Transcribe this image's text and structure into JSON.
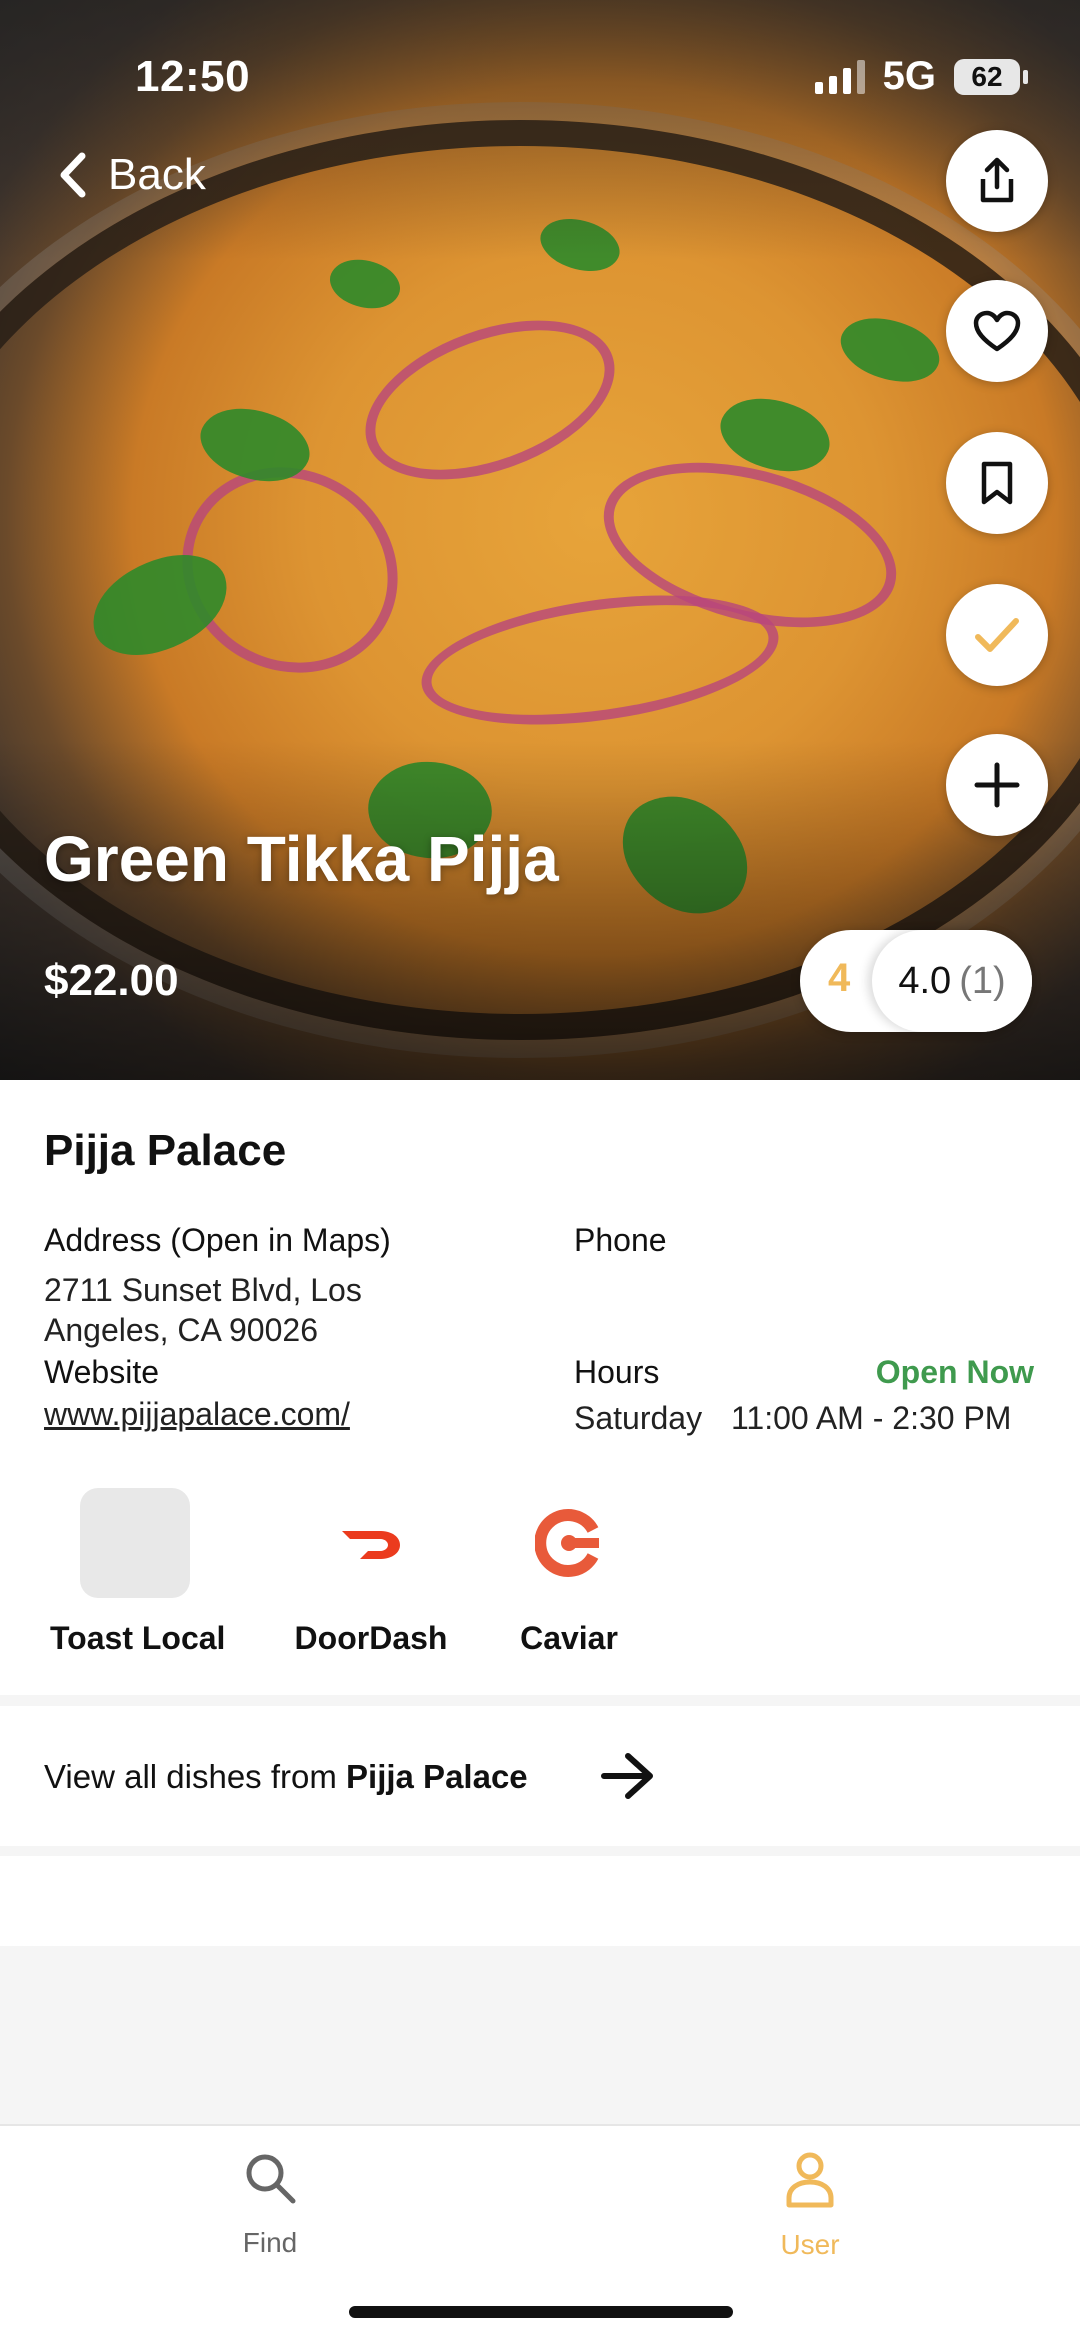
{
  "status_bar": {
    "time": "12:50",
    "network": "5G",
    "battery": "62"
  },
  "nav": {
    "back_label": "Back"
  },
  "dish": {
    "name": "Green Tikka Pijja",
    "price": "$22.00"
  },
  "rating": {
    "my_rating": "4",
    "average": "4.0",
    "count": "(1)"
  },
  "actions": [
    {
      "name": "share-icon"
    },
    {
      "name": "heart-icon"
    },
    {
      "name": "bookmark-icon"
    },
    {
      "name": "check-icon"
    },
    {
      "name": "plus-icon"
    }
  ],
  "restaurant": {
    "name": "Pijja Palace",
    "address_label": "Address (Open in Maps)",
    "address_line1": "2711 Sunset Blvd, Los",
    "address_line2": "Angeles, CA 90026",
    "phone_label": "Phone",
    "website_label": "Website",
    "website": "www.pijjapalace.com/",
    "hours_label": "Hours",
    "open_status": "Open Now",
    "hours_day": "Saturday",
    "hours_time": "11:00 AM - 2:30 PM"
  },
  "delivery_services": [
    {
      "label": "Toast Local"
    },
    {
      "label": "DoorDash"
    },
    {
      "label": "Caviar"
    }
  ],
  "dishes_link": {
    "prefix": "View all dishes from",
    "restaurant": "Pijja Palace"
  },
  "tabs": [
    {
      "label": "Find",
      "icon": "search-icon"
    },
    {
      "label": "User",
      "icon": "user-icon"
    }
  ],
  "colors": {
    "accent": "#f0b95a",
    "open_green": "#3f9a4e",
    "doordash": "#eb3b1e",
    "caviar": "#e85a3a"
  }
}
